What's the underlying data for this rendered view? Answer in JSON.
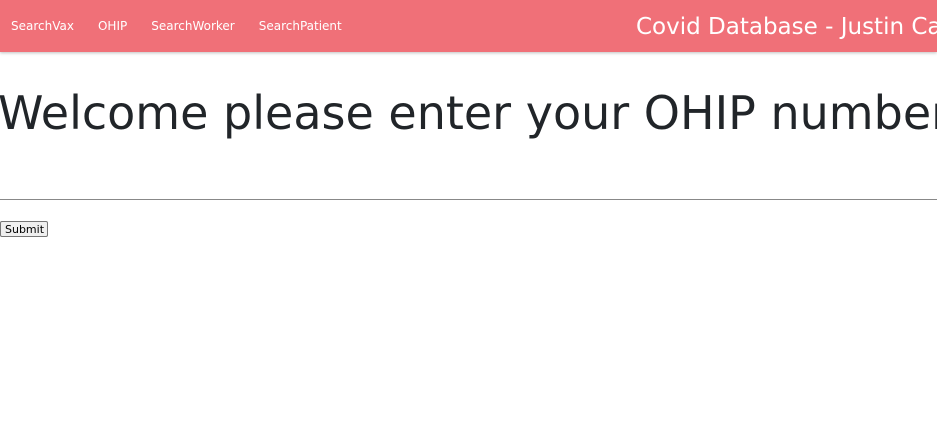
{
  "navbar": {
    "links": [
      {
        "label": "SearchVax"
      },
      {
        "label": "OHIP"
      },
      {
        "label": "SearchWorker"
      },
      {
        "label": "SearchPatient"
      }
    ],
    "brand": "Covid Database - Justin Carr",
    "background_color": "#f07078"
  },
  "main": {
    "heading": "Welcome please enter your OHIP number",
    "ohip_input": {
      "value": "",
      "placeholder": ""
    },
    "submit_label": "Submit"
  }
}
